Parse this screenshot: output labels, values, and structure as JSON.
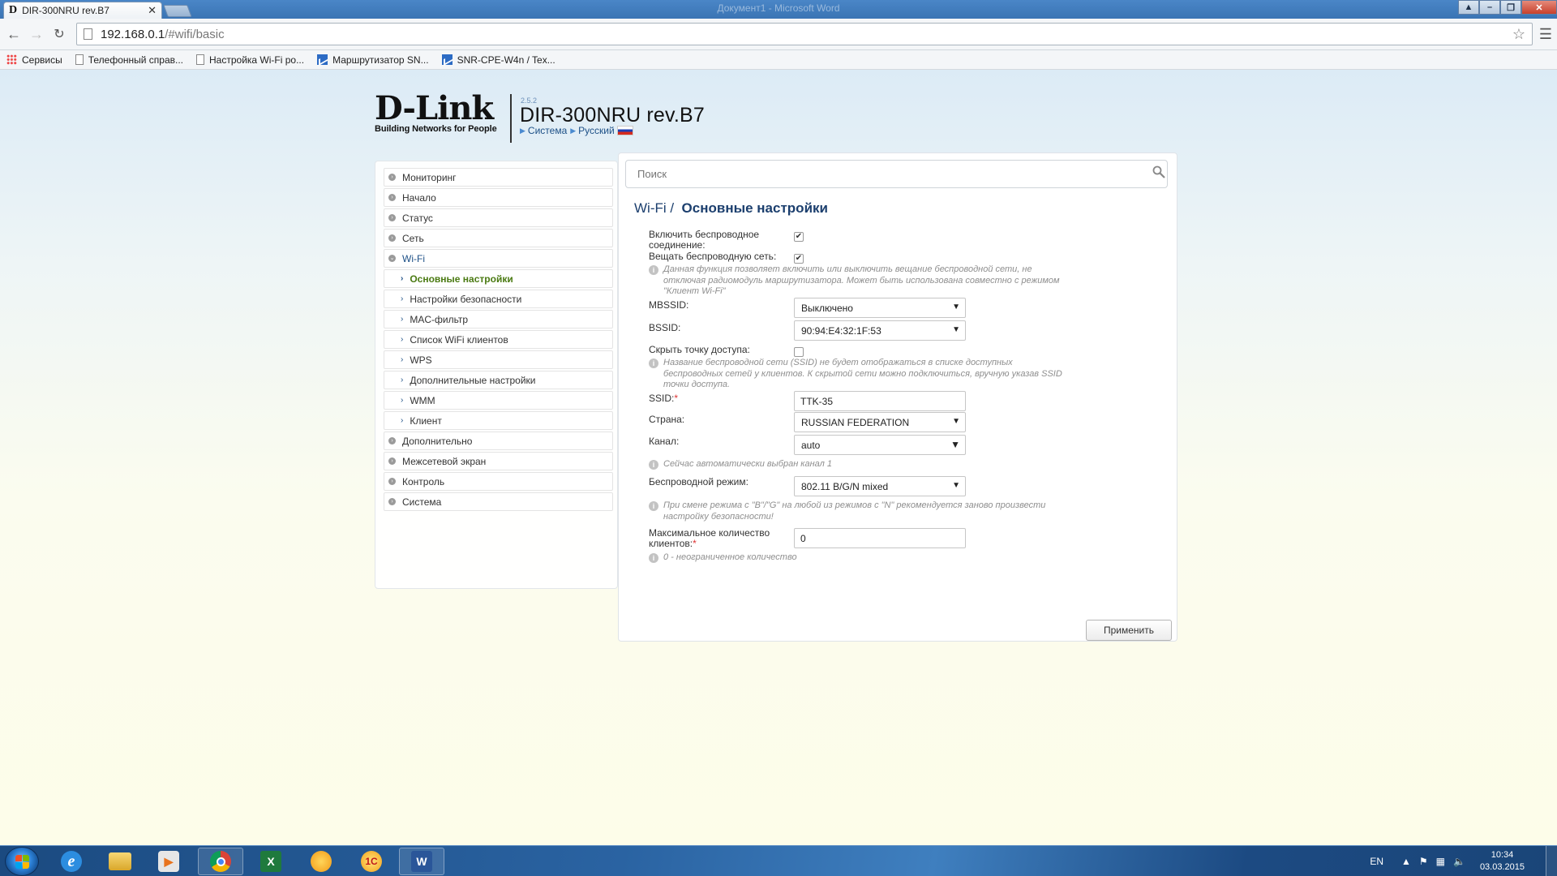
{
  "browser": {
    "tab_title": "DIR-300NRU rev.B7",
    "window_title": "Документ1 - Microsoft Word",
    "url_host": "192.168.0.1",
    "url_path": "/#wifi/basic",
    "bookmarks": [
      "Сервисы",
      "Телефонный справ...",
      "Настройка Wi-Fi ро...",
      "Маршрутизатор SN...",
      "SNR-CPE-W4n / Tex..."
    ]
  },
  "header": {
    "logo": "D-Link",
    "logo_tagline": "Building Networks for People",
    "firmware": "2.5.2",
    "model": "DIR-300NRU rev.B7",
    "crumb_system": "Система",
    "crumb_language": "Русский"
  },
  "sidebar": {
    "items": [
      "Мониторинг",
      "Начало",
      "Статус",
      "Сеть",
      "Wi-Fi"
    ],
    "wifi_subitems": [
      "Основные настройки",
      "Настройки безопасности",
      "MAC-фильтр",
      "Список WiFi клиентов",
      "WPS",
      "Дополнительные настройки",
      "WMM",
      "Клиент"
    ],
    "bottom_items": [
      "Дополнительно",
      "Межсетевой экран",
      "Контроль",
      "Система"
    ]
  },
  "content": {
    "search_placeholder": "Поиск",
    "title_section": "Wi-Fi /",
    "title_page": "Основные настройки",
    "enable_wireless_label": "Включить беспроводное соединение:",
    "broadcast_label": "Вещать беспроводную сеть:",
    "broadcast_hint": "Данная функция позволяет включить или выключить вещание беспроводной сети, не отключая радиомодуль маршрутизатора. Может быть использована совместно с режимом \"Клиент Wi-Fi\"",
    "mbssid_label": "MBSSID:",
    "mbssid_value": "Выключено",
    "bssid_label": "BSSID:",
    "bssid_value": "90:94:E4:32:1F:53",
    "hide_ap_label": "Скрыть точку доступа:",
    "hide_ap_hint": "Название беспроводной сети (SSID) не будет отображаться в списке доступных беспроводных сетей у клиентов. К скрытой сети можно подключиться, вручную указав SSID точки доступа.",
    "ssid_label": "SSID:",
    "ssid_value": "TTK-35",
    "country_label": "Страна:",
    "country_value": "RUSSIAN FEDERATION",
    "channel_label": "Канал:",
    "channel_value": "auto",
    "channel_hint": "Сейчас автоматически выбран канал 1",
    "mode_label": "Беспроводной режим:",
    "mode_value": "802.11 B/G/N mixed",
    "mode_hint": "При смене режима с \"B\"/\"G\" на любой из режимов с \"N\" рекомендуется заново произвести настройку безопасности!",
    "max_clients_label": "Максимальное количество клиентов:",
    "max_clients_value": "0",
    "max_clients_hint": "0 - неограниченное количество",
    "apply_label": "Применить"
  },
  "taskbar": {
    "lang": "EN",
    "time": "10:34",
    "date": "03.03.2015"
  }
}
